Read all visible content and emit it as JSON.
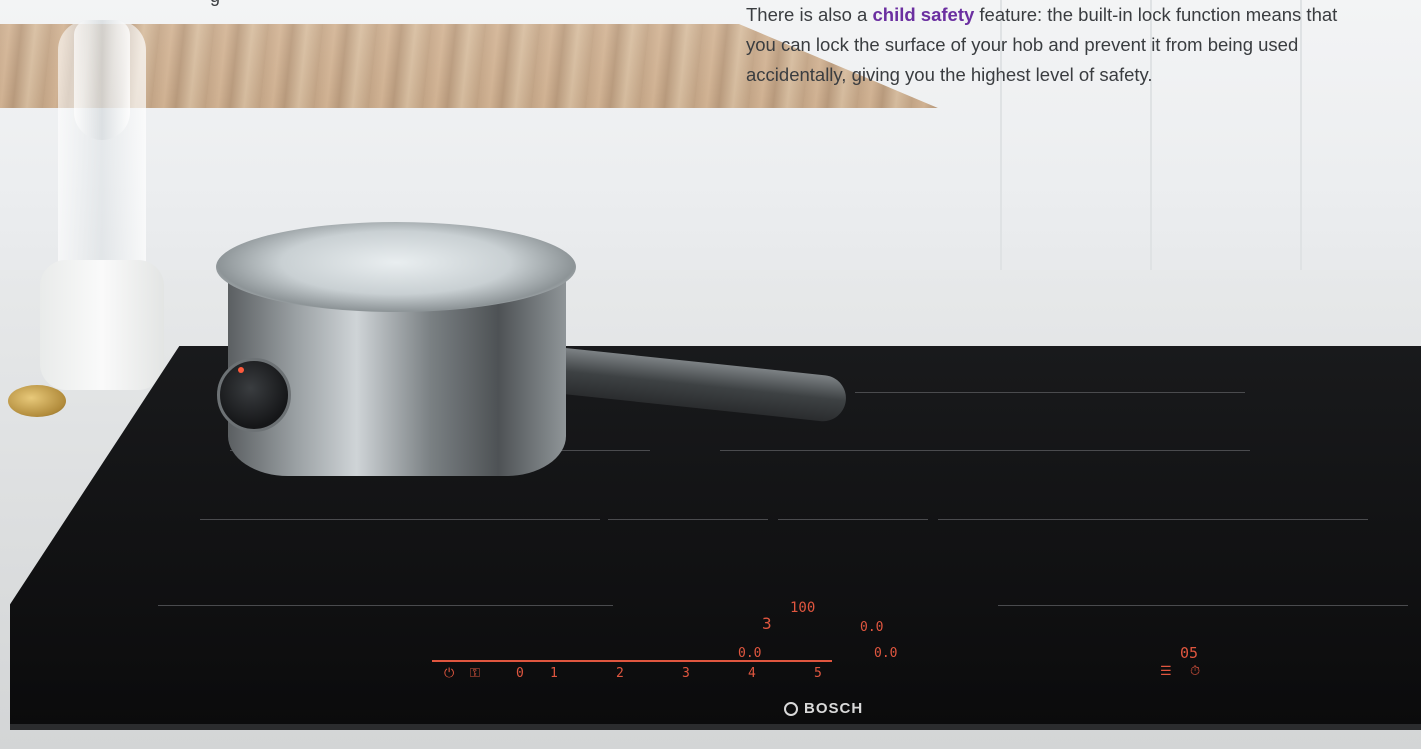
{
  "copy": {
    "part1": "There is also a ",
    "highlight": "child safety",
    "part2": " feature: the built-in lock function means that you can lock the surface of your hob and prevent it from being used accidentally, giving you the highest level of safety.",
    "highlight_color": "#6b2fa0"
  },
  "top_fragment": "g",
  "brand": {
    "name": "BOSCH",
    "icon": "bosch-logo-icon"
  },
  "display": {
    "top": "100",
    "left_level": "3",
    "readouts": [
      "0.0",
      "0.0",
      "0.0"
    ],
    "timer": "05",
    "scale": [
      "0",
      "1",
      "2",
      "3",
      "4",
      "5"
    ]
  },
  "colors": {
    "display": "#e0563f",
    "hob": "#111214"
  }
}
